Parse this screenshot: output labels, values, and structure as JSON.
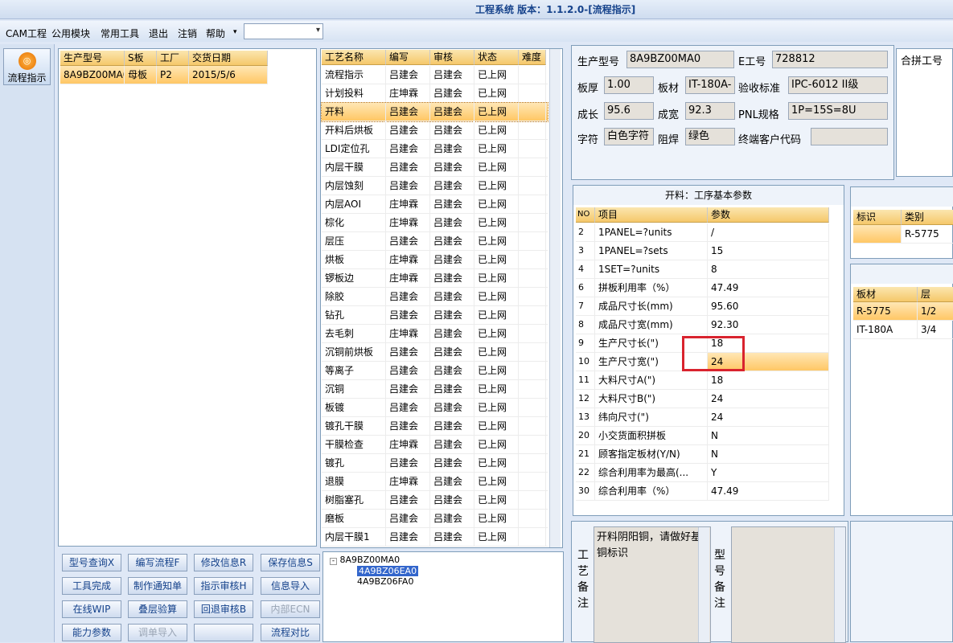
{
  "window": {
    "title": "工程系统 版本：1.1.2.0-[流程指示]"
  },
  "menu": [
    {
      "label": "CAM工程"
    },
    {
      "label": "公用模块"
    },
    {
      "label": "常用工具"
    },
    {
      "label": "退出"
    },
    {
      "label": "注销"
    },
    {
      "label": "帮助"
    }
  ],
  "menu_help_arrow": "▾",
  "combo": {
    "value": ""
  },
  "nav": {
    "label": "流程指示",
    "icon": "process-icon"
  },
  "order_grid": {
    "headers": [
      "生产型号",
      "S板",
      "工厂",
      "交货日期"
    ],
    "rows": [
      [
        "8A9BZ00MA0",
        "母板",
        "P2",
        "2015/5/6"
      ]
    ]
  },
  "process_grid": {
    "headers": [
      "工艺名称",
      "编写",
      "审核",
      "状态",
      "难度"
    ],
    "rows": [
      [
        "流程指示",
        "吕建会",
        "吕建会",
        "已上网",
        ""
      ],
      [
        "计划投料",
        "庄坤霖",
        "吕建会",
        "已上网",
        ""
      ],
      [
        "开料",
        "吕建会",
        "吕建会",
        "已上网",
        ""
      ],
      [
        "开料后烘板",
        "吕建会",
        "吕建会",
        "已上网",
        ""
      ],
      [
        "LDI定位孔",
        "吕建会",
        "吕建会",
        "已上网",
        ""
      ],
      [
        "内层干膜",
        "吕建会",
        "吕建会",
        "已上网",
        ""
      ],
      [
        "内层蚀刻",
        "吕建会",
        "吕建会",
        "已上网",
        ""
      ],
      [
        "内层AOI",
        "庄坤霖",
        "吕建会",
        "已上网",
        ""
      ],
      [
        "棕化",
        "庄坤霖",
        "吕建会",
        "已上网",
        ""
      ],
      [
        "层压",
        "吕建会",
        "吕建会",
        "已上网",
        ""
      ],
      [
        "烘板",
        "庄坤霖",
        "吕建会",
        "已上网",
        ""
      ],
      [
        "锣板边",
        "庄坤霖",
        "吕建会",
        "已上网",
        ""
      ],
      [
        "除胶",
        "吕建会",
        "吕建会",
        "已上网",
        ""
      ],
      [
        "钻孔",
        "吕建会",
        "吕建会",
        "已上网",
        ""
      ],
      [
        "去毛刺",
        "庄坤霖",
        "吕建会",
        "已上网",
        ""
      ],
      [
        "沉铜前烘板",
        "吕建会",
        "吕建会",
        "已上网",
        ""
      ],
      [
        "等离子",
        "吕建会",
        "吕建会",
        "已上网",
        ""
      ],
      [
        "沉铜",
        "吕建会",
        "吕建会",
        "已上网",
        ""
      ],
      [
        "板镀",
        "吕建会",
        "吕建会",
        "已上网",
        ""
      ],
      [
        "镀孔干膜",
        "吕建会",
        "吕建会",
        "已上网",
        ""
      ],
      [
        "干膜检查",
        "庄坤霖",
        "吕建会",
        "已上网",
        ""
      ],
      [
        "镀孔",
        "吕建会",
        "吕建会",
        "已上网",
        ""
      ],
      [
        "退膜",
        "庄坤霖",
        "吕建会",
        "已上网",
        ""
      ],
      [
        "树脂塞孔",
        "吕建会",
        "吕建会",
        "已上网",
        ""
      ],
      [
        "磨板",
        "吕建会",
        "吕建会",
        "已上网",
        ""
      ],
      [
        "内层干膜1",
        "吕建会",
        "吕建会",
        "已上网",
        ""
      ]
    ]
  },
  "info": {
    "model_label": "生产型号",
    "model": "8A9BZ00MA0",
    "eno_label": "E工号",
    "eno": "728812",
    "thick_label": "板厚",
    "thick": "1.00",
    "mat_label": "板材",
    "mat": "IT-180A-",
    "std_label": "验收标准",
    "std": "IPC-6012 II级",
    "len_label": "成长",
    "len": "95.6",
    "wid_label": "成宽",
    "wid": "92.3",
    "pnl_label": "PNL规格",
    "pnl": "1P=15S=8U",
    "char_label": "字符",
    "char": "白色字符",
    "mask_label": "阻焊",
    "mask": "绿色",
    "cust_label": "终端客户代码",
    "cust": "",
    "combine_label": "合拼工号"
  },
  "params": {
    "title": "开料：工序基本参数",
    "headers": [
      "NO",
      "项目",
      "参数"
    ],
    "rows": [
      [
        "2",
        "1PANEL=?units",
        "/"
      ],
      [
        "3",
        "1PANEL=?sets",
        "15"
      ],
      [
        "4",
        "1SET=?units",
        "8"
      ],
      [
        "6",
        "拼板利用率（%）",
        "47.49"
      ],
      [
        "7",
        "成品尺寸长(mm)",
        "95.60"
      ],
      [
        "8",
        "成品尺寸宽(mm)",
        "92.30"
      ],
      [
        "9",
        "生产尺寸长(\")",
        "18"
      ],
      [
        "10",
        "生产尺寸宽(\")",
        "24"
      ],
      [
        "11",
        "大料尺寸A(\")",
        "18"
      ],
      [
        "12",
        "大料尺寸B(\")",
        "24"
      ],
      [
        "13",
        "纬向尺寸(\")",
        "24"
      ],
      [
        "20",
        "小交货面积拼板",
        "N"
      ],
      [
        "21",
        "顾客指定板材(Y/N)",
        "N"
      ],
      [
        "22",
        "综合利用率为最高(...",
        "Y"
      ],
      [
        "30",
        "综合利用率（%）",
        "47.49"
      ]
    ]
  },
  "mark_grid": {
    "headers": [
      "标识",
      "类别"
    ],
    "rows": [
      [
        "",
        "R-5775"
      ]
    ]
  },
  "board_grid": {
    "headers": [
      "板材",
      "层"
    ],
    "rows": [
      [
        "R-5775",
        "1/2"
      ],
      [
        "IT-180A",
        "3/4"
      ]
    ]
  },
  "remarks": {
    "process_label": "工艺备注",
    "process_text": "开料阴阳铜，请做好基铜标识",
    "model_label": "型号备注",
    "model_text": ""
  },
  "buttons": [
    {
      "label": "型号查询X"
    },
    {
      "label": "编写流程F"
    },
    {
      "label": "修改信息R"
    },
    {
      "label": "保存信息S"
    },
    {
      "label": "工具完成"
    },
    {
      "label": "制作通知单"
    },
    {
      "label": "指示审核H"
    },
    {
      "label": "信息导入"
    },
    {
      "label": "在线WIP"
    },
    {
      "label": "叠层验算"
    },
    {
      "label": "回退审核B"
    },
    {
      "label": "内部ECN"
    },
    {
      "label": "能力参数"
    },
    {
      "label": "调单导入"
    },
    {
      "label": ""
    },
    {
      "label": "流程对比"
    }
  ],
  "tree": {
    "root": "8A9BZ00MA0",
    "children": [
      "4A9BZ06EA0",
      "4A9BZ06FA0"
    ]
  },
  "colors": {
    "accent": "#f5c86a",
    "highlight": "#d9232e",
    "frame": "#dfe8f6"
  }
}
